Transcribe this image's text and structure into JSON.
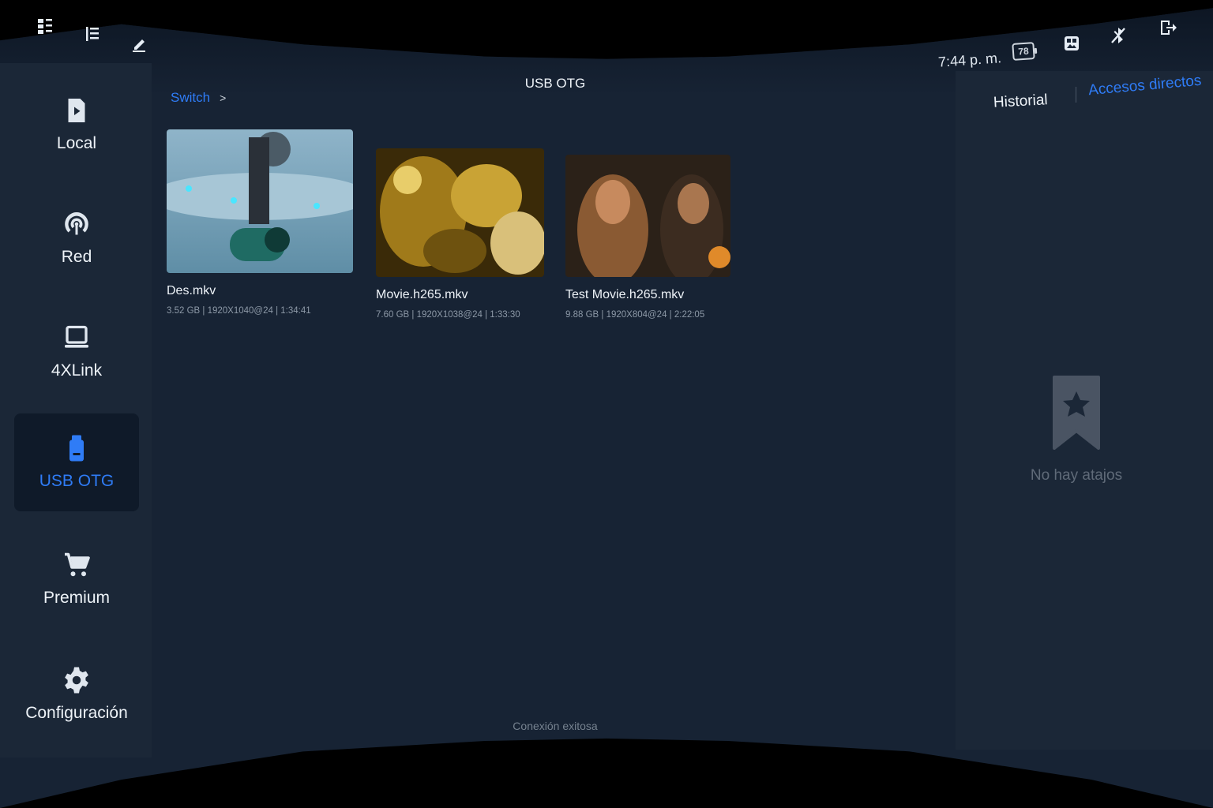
{
  "topbar": {
    "icons": [
      "grid-menu-icon",
      "list-sort-icon",
      "edit-icon",
      "image-gallery-icon",
      "no-bluetooth-icon",
      "exit-icon"
    ],
    "clock": "7:44 p. m.",
    "battery": "78"
  },
  "sidebar": {
    "items": [
      {
        "label": "Local",
        "icon": "play-file-icon",
        "active": false
      },
      {
        "label": "Red",
        "icon": "network-icon",
        "active": false
      },
      {
        "label": "4XLink",
        "icon": "laptop-icon",
        "active": false
      },
      {
        "label": "USB OTG",
        "icon": "usb-drive-icon",
        "active": true
      },
      {
        "label": "Premium",
        "icon": "cart-icon",
        "active": false
      },
      {
        "label": "Configuración",
        "icon": "gear-icon",
        "active": false
      }
    ]
  },
  "main": {
    "title": "USB OTG",
    "breadcrumb": {
      "crumb": "Switch",
      "separator": ">"
    },
    "files": [
      {
        "name": "Des.mkv",
        "meta": "3.52 GB | 1920X1040@24 | 1:34:41"
      },
      {
        "name": "Movie.h265.mkv",
        "meta": "7.60 GB | 1920X1038@24 | 1:33:30"
      },
      {
        "name": "Test Movie.h265.mkv",
        "meta": "9.88 GB | 1920X804@24 | 2:22:05"
      }
    ],
    "status": "Conexión exitosa"
  },
  "rightpanel": {
    "tabs": {
      "historial": "Historial",
      "accesos": "Accesos directos"
    },
    "empty_text": "No hay atajos"
  },
  "colors": {
    "accent": "#2f7cf6",
    "panel": "#172334",
    "sidebar": "#1b2737"
  }
}
